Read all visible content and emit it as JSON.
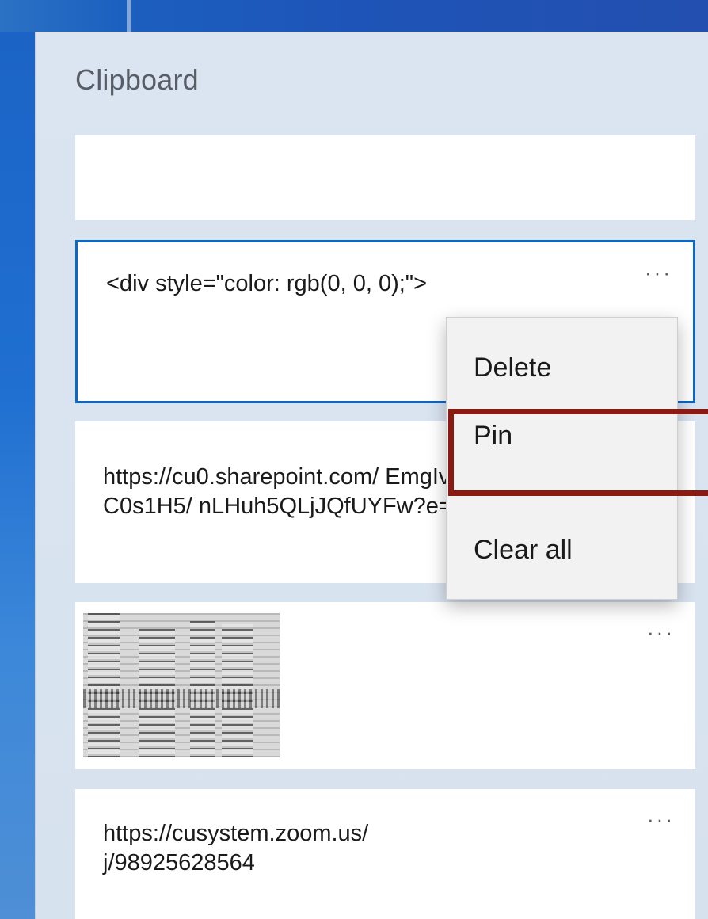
{
  "panel": {
    "title": "Clipboard"
  },
  "items": [
    {
      "text": ""
    },
    {
      "text": "<div style=\"color: rgb(0, 0, 0);\">",
      "more": "···"
    },
    {
      "text": "https://cu0.sharepoint.com/\nEmgIvzn30aZMrO8C0s1H5/\nnLHuh5QLjJQfUYFw?e=GgF",
      "more": "···"
    },
    {
      "type": "image",
      "more": "···"
    },
    {
      "text": "https://cusystem.zoom.us/\nj/98925628564",
      "more": "···"
    }
  ],
  "context_menu": {
    "items": [
      "Delete",
      "Pin",
      "Clear all"
    ]
  },
  "colors": {
    "panel_bg": "#dbe5f1",
    "selected_border": "#0b67c9",
    "highlight": "#8b1a12"
  },
  "icons": {
    "more": "more-options-icon"
  }
}
